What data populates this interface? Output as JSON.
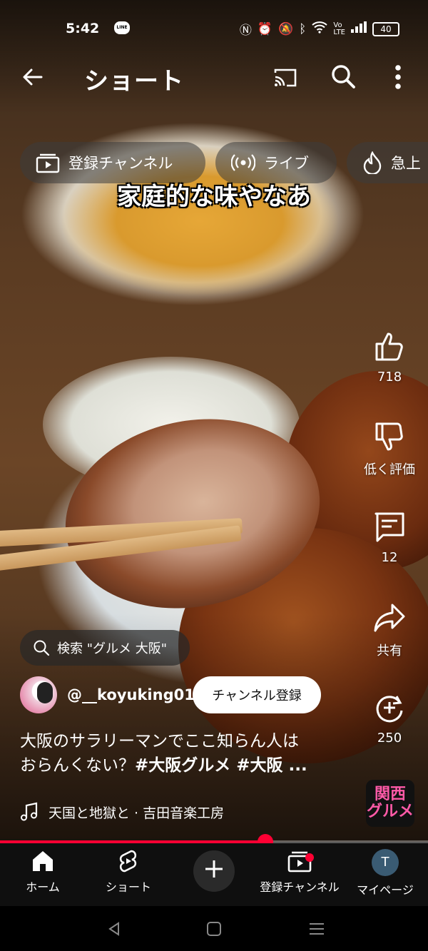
{
  "status_bar": {
    "time": "5:42",
    "line_badge": "LINE",
    "battery": "40"
  },
  "app_bar": {
    "title": "ショート"
  },
  "chips": [
    {
      "label": "登録チャンネル",
      "icon": "subscriptions-icon"
    },
    {
      "label": "ライブ",
      "icon": "live-icon"
    },
    {
      "label": "急上",
      "icon": "trending-icon"
    }
  ],
  "video": {
    "overlay_caption": "家庭的な味やなあ",
    "progress_fraction": 0.62
  },
  "actions": {
    "likes": "718",
    "dislike_label": "低く評価",
    "comments": "12",
    "share_label": "共有",
    "remix_count": "250"
  },
  "search_pill": {
    "text": "検索 \"グルメ 大阪\""
  },
  "channel": {
    "handle": "@__koyuking01",
    "subscribe_label": "チャンネル登録"
  },
  "description": {
    "line1": "大阪のサラリーマンでここ知らん人は",
    "line2_plain": "おらんくない？",
    "line2_tags": "#大阪グルメ #大阪 ..."
  },
  "music": {
    "text": "天国と地獄と · 吉田音楽工房"
  },
  "brand_badge": {
    "top": "関西",
    "bottom": "グルメ"
  },
  "bottom_nav": {
    "home": "ホーム",
    "shorts": "ショート",
    "subscriptions": "登録チャンネル",
    "you": "マイページ",
    "you_initial": "T"
  },
  "colors": {
    "accent": "#ff0033",
    "nav_bg": "#0f0f0f"
  }
}
